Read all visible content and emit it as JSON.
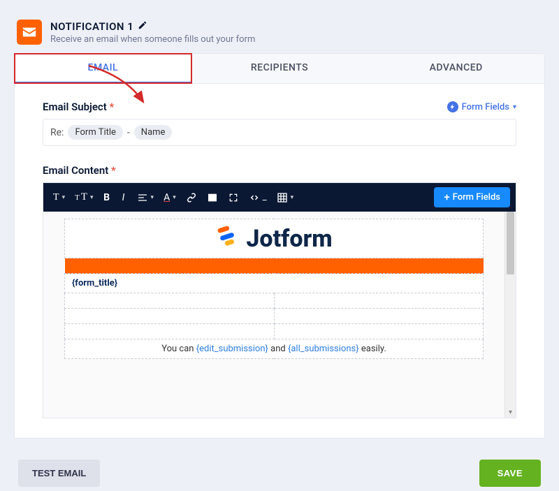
{
  "header": {
    "title": "NOTIFICATION 1",
    "subtitle": "Receive an email when someone fills out your form"
  },
  "tabs": {
    "email": "EMAIL",
    "recipients": "RECIPIENTS",
    "advanced": "ADVANCED"
  },
  "subject": {
    "label": "Email Subject",
    "form_fields_link": "Form Fields",
    "prefix": "Re:",
    "pill1": "Form Title",
    "sep": "-",
    "pill2": "Name"
  },
  "content": {
    "label": "Email Content",
    "add_button": "Form Fields",
    "logo_text": "Jotform",
    "form_title_var": "{form_title}",
    "footer_pre": "You can ",
    "footer_link1": "{edit_submission}",
    "footer_mid": " and ",
    "footer_link2": "{all_submissions}",
    "footer_post": " easily."
  },
  "actions": {
    "test": "TEST EMAIL",
    "save": "SAVE"
  },
  "icons": {
    "envelope": "envelope-icon",
    "pencil": "pencil-icon",
    "lightning": "lightning-icon",
    "chevron_down": "chevron-down-icon"
  }
}
